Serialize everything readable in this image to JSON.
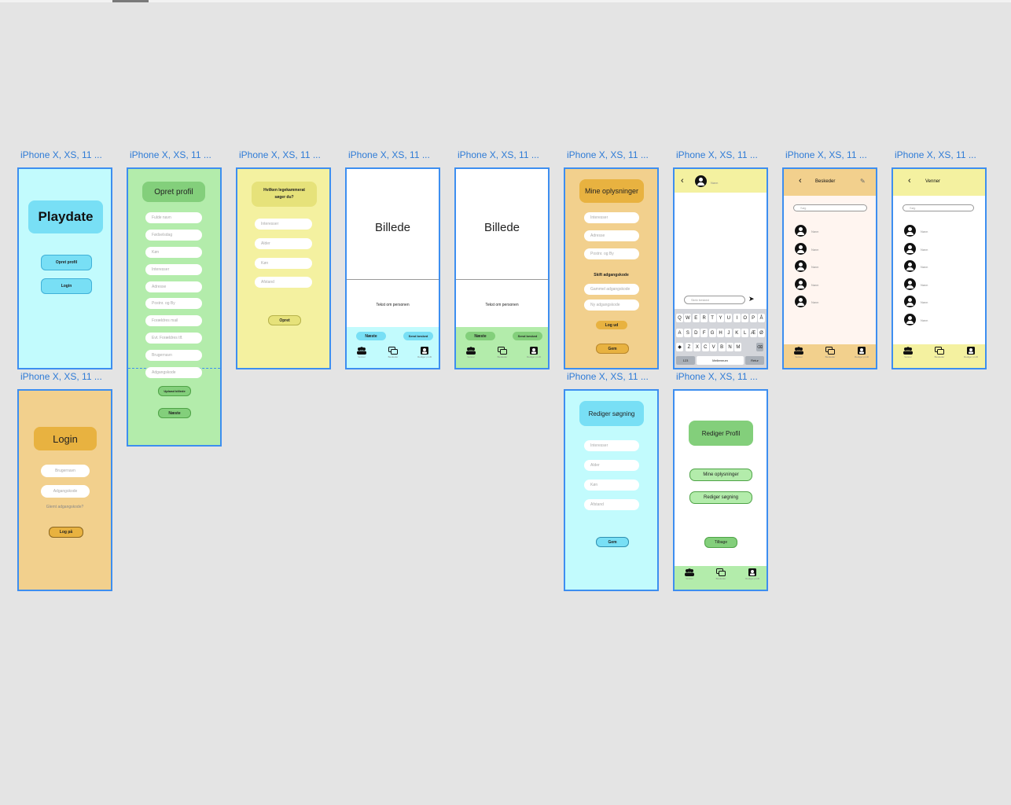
{
  "frame_label": "iPhone X, XS, 11 ...",
  "welcome": {
    "title": "Playdate",
    "create_btn": "Opret profil",
    "login_btn": "Login"
  },
  "create_profile": {
    "title": "Opret profil",
    "fields": [
      "Fulde navn",
      "Fødselsdag",
      "Køn",
      "Interesser",
      "Adresse",
      "Postnr. og By",
      "Forældres mail",
      "Evt. Forældres tlf.",
      "Brugernavn",
      "Adgangskode"
    ],
    "upload_btn": "Upload billede",
    "next_btn": "Næste"
  },
  "search": {
    "title": "Hvilken legekammerat søger du?",
    "fields": [
      "Interesser",
      "Alder",
      "Køn",
      "Afstand"
    ],
    "submit": "Opret"
  },
  "profile_view": {
    "image": "Billede",
    "text": "Tekst om personen",
    "next_btn": "Næste",
    "send_btn": "Send besked"
  },
  "tabs": [
    "Venner",
    "Beskeder",
    "Rediger profil"
  ],
  "my_info": {
    "title": "Mine oplysninger",
    "fields": [
      "Interesser",
      "Adresse",
      "Postnr. og By"
    ],
    "change_pw": "Skift adgangskode",
    "pw_fields": [
      "Gammel adgangskode",
      "Ny adgangskode"
    ],
    "logout_btn": "Log ud",
    "save_btn": "Gem"
  },
  "chat": {
    "name": "Navn",
    "input_placeholder": "Skriv besked",
    "keyboard_rows": [
      [
        "Q",
        "W",
        "E",
        "R",
        "T",
        "Y",
        "U",
        "I",
        "O",
        "P",
        "Å"
      ],
      [
        "A",
        "S",
        "D",
        "F",
        "G",
        "H",
        "J",
        "K",
        "L",
        "Æ",
        "Ø"
      ],
      [
        "Z",
        "X",
        "C",
        "V",
        "B",
        "N",
        "M"
      ]
    ],
    "key_123": "123",
    "key_space": "Mellemrum",
    "key_return": "Retur"
  },
  "messages": {
    "title": "Beskeder",
    "search": "Søg",
    "item_name": "Navn"
  },
  "friends": {
    "title": "Venner",
    "search": "Søg",
    "item_name": "Navn"
  },
  "login": {
    "title": "Login",
    "username": "Brugernavn",
    "password": "Adgangskode",
    "forgot": "Glemt adgangskode?",
    "submit": "Log på"
  },
  "edit_search": {
    "title": "Rediger søgning",
    "fields": [
      "Interesser",
      "Alder",
      "Køn",
      "Afstand"
    ],
    "save_btn": "Gem"
  },
  "edit_profile": {
    "title": "Rediger Profil",
    "my_info_btn": "Mine oplysninger",
    "edit_search_btn": "Rediger søgning",
    "back_btn": "Tilbage"
  },
  "colors": {
    "canvas": "#e4e4e4",
    "frame_border": "#3d8ef0",
    "cyan_bg": "#c2fbfd",
    "green_bg": "#b3ecab",
    "yellow_bg": "#f4f1a0",
    "orange_bg": "#f2d08d"
  }
}
